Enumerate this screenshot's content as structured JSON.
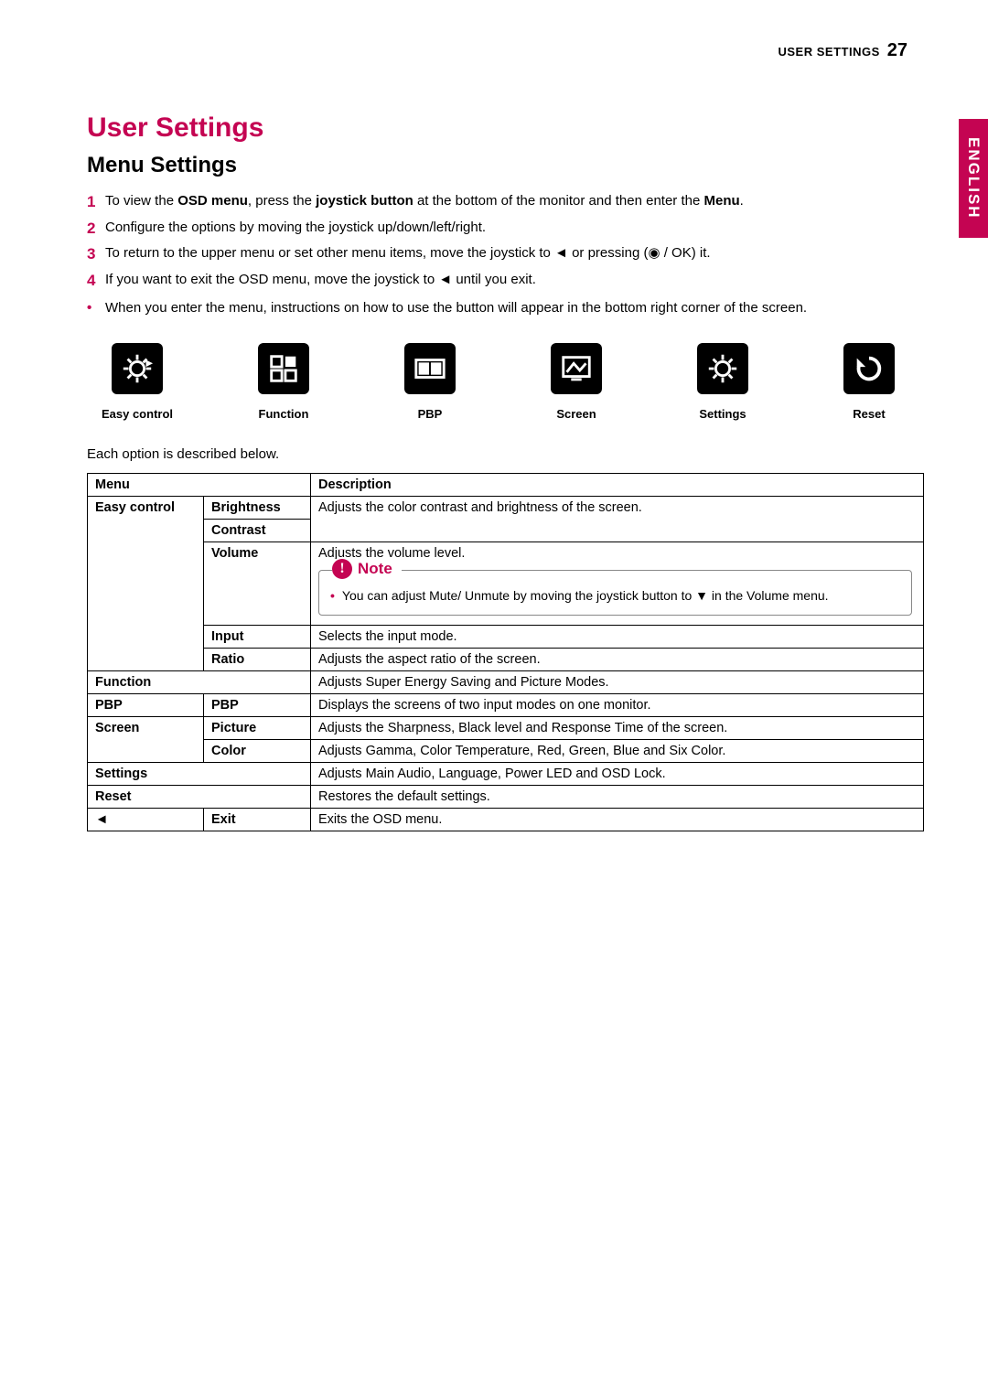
{
  "header": {
    "section": "USER SETTINGS",
    "page": "27"
  },
  "language_tab": "ENGLISH",
  "title": "User Settings",
  "subtitle": "Menu Settings",
  "steps": {
    "s1_a": "To view the ",
    "s1_b": "OSD menu",
    "s1_c": ", press the ",
    "s1_d": "joystick button",
    "s1_e": " at the bottom of the monitor and then enter the ",
    "s1_f": "Menu",
    "s1_g": ".",
    "s2": "Configure the options by moving the joystick up/down/left/right.",
    "s3": "To return to the upper menu or set other menu items, move the joystick to ◄ or pressing (◉ / OK) it.",
    "s4": "If you want to exit the OSD menu, move the joystick to ◄ until you exit.",
    "bullet": "When you enter the menu, instructions on how to use the button will appear in the bottom right corner of the screen."
  },
  "icons": [
    {
      "label": "Easy control"
    },
    {
      "label": "Function"
    },
    {
      "label": "PBP"
    },
    {
      "label": "Screen"
    },
    {
      "label": "Settings"
    },
    {
      "label": "Reset"
    }
  ],
  "intro_below": "Each option is described below.",
  "table": {
    "head_menu": "Menu",
    "head_desc": "Description",
    "easy_control": "Easy control",
    "brightness": "Brightness",
    "contrast": "Contrast",
    "brightness_desc": "Adjusts the color contrast and brightness of the screen.",
    "volume": "Volume",
    "volume_desc": "Adjusts the volume level.",
    "note_label": "Note",
    "note_text": "You can adjust Mute/ Unmute by moving the joystick button to ▼ in the Volume menu.",
    "input": "Input",
    "input_desc": "Selects the input mode.",
    "ratio": "Ratio",
    "ratio_desc": "Adjusts the aspect ratio of the screen.",
    "function": "Function",
    "function_desc": "Adjusts Super Energy Saving and Picture Modes.",
    "pbp": "PBP",
    "pbp_sub": "PBP",
    "pbp_desc": "Displays the screens of two input modes on one monitor.",
    "screen": "Screen",
    "picture": "Picture",
    "picture_desc": "Adjusts the Sharpness, Black level and Response Time of the screen.",
    "color": "Color",
    "color_desc": "Adjusts Gamma, Color Temperature, Red, Green, Blue and Six Color.",
    "settings": "Settings",
    "settings_desc": "Adjusts Main Audio, Language, Power LED and OSD Lock.",
    "reset": "Reset",
    "reset_desc": "Restores the default settings.",
    "back_arrow": "◄",
    "exit": "Exit",
    "exit_desc": "Exits the OSD menu."
  }
}
